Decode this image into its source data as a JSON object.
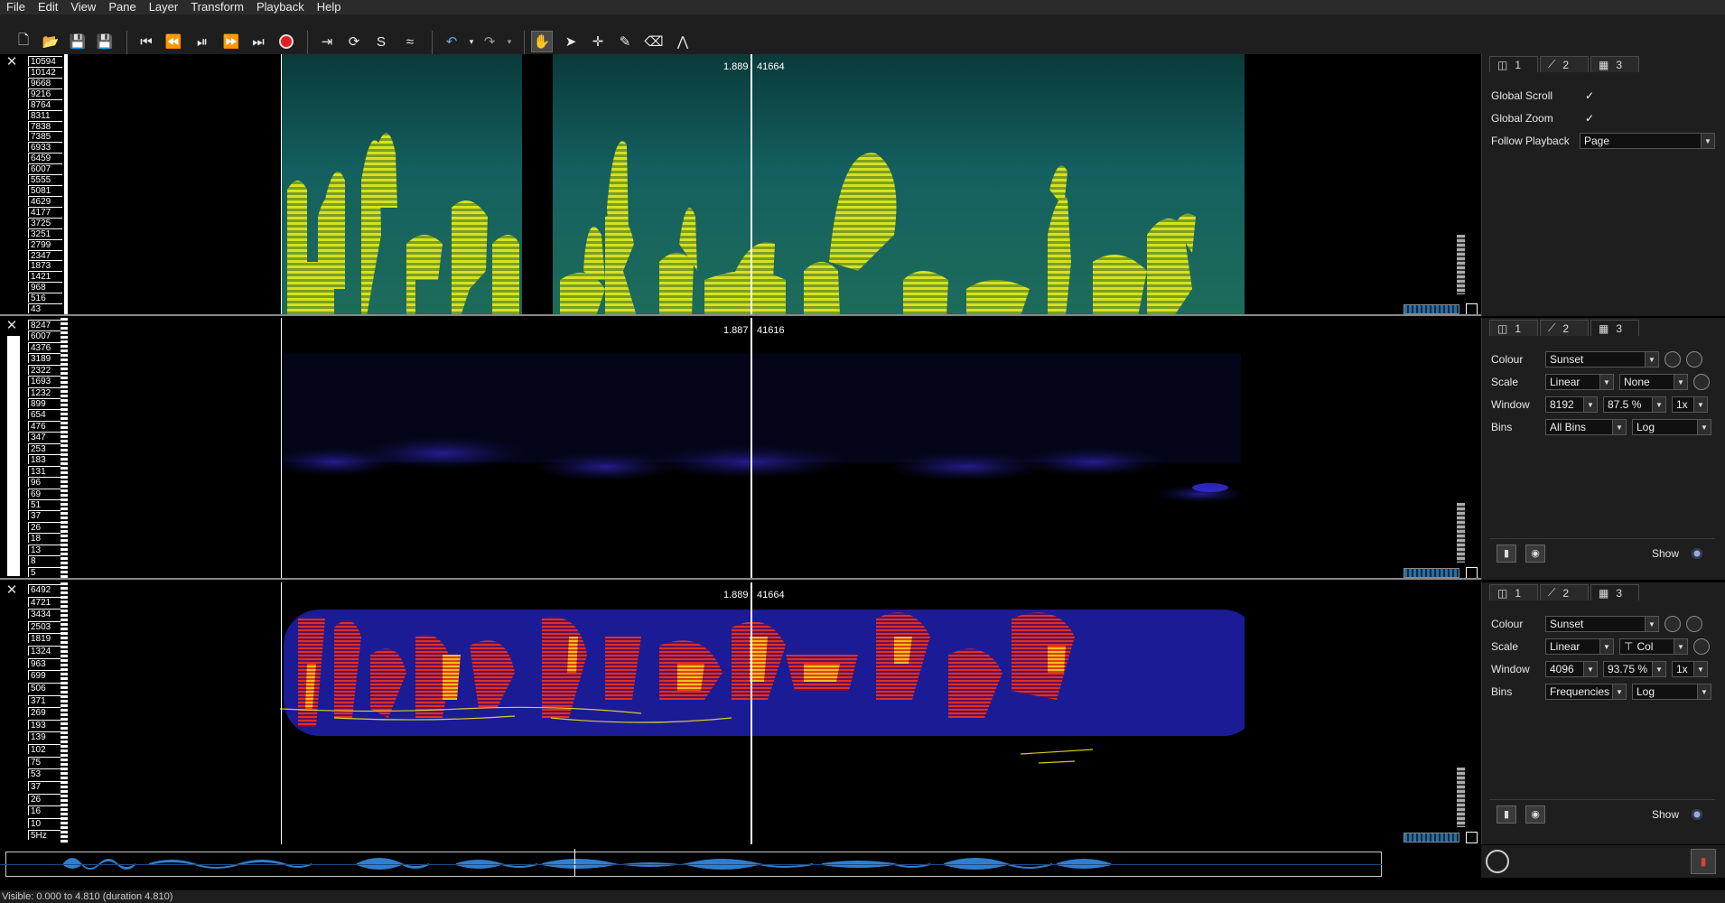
{
  "menu": [
    "File",
    "Edit",
    "View",
    "Pane",
    "Layer",
    "Transform",
    "Playback",
    "Help"
  ],
  "toolbar_icons": [
    "new-icon",
    "open-icon",
    "save-icon",
    "save-as-icon",
    "rewind-start-icon",
    "rewind-icon",
    "play-pause-icon",
    "fast-forward-icon",
    "fast-forward-end-icon",
    "record-icon",
    "play-selection-icon",
    "loop-icon",
    "solo-icon",
    "normalize-icon",
    "undo-icon",
    "redo-icon",
    "navigate-tool-icon",
    "select-tool-icon",
    "edit-tool-icon",
    "draw-tool-icon",
    "erase-tool-icon",
    "measure-tool-icon"
  ],
  "pane1": {
    "playhead_time": "1.889",
    "playhead_freq": "41664",
    "scale": [
      "10594",
      "10142",
      "9668",
      "9216",
      "8764",
      "8311",
      "7838",
      "7385",
      "6933",
      "6459",
      "6007",
      "5555",
      "5081",
      "4629",
      "4177",
      "3725",
      "3251",
      "2799",
      "2347",
      "1873",
      "1421",
      "968",
      "516",
      "43"
    ]
  },
  "pane2": {
    "playhead_time": "1.887",
    "playhead_freq": "41616",
    "scale": [
      "8247",
      "6007",
      "4376",
      "3189",
      "2322",
      "1693",
      "1232",
      "899",
      "654",
      "476",
      "347",
      "253",
      "183",
      "131",
      "96",
      "69",
      "51",
      "37",
      "26",
      "18",
      "13",
      "8",
      "5"
    ]
  },
  "pane3": {
    "playhead_time": "1.889",
    "playhead_freq": "41664",
    "scale": [
      "6492",
      "4721",
      "3434",
      "2503",
      "1819",
      "1324",
      "963",
      "699",
      "506",
      "371",
      "269",
      "193",
      "139",
      "102",
      "75",
      "53",
      "37",
      "26",
      "16",
      "10",
      "5Hz"
    ]
  },
  "panel1": {
    "tabs": [
      "1",
      "2",
      "3"
    ],
    "global_scroll_label": "Global Scroll",
    "global_scroll_checked": "✓",
    "global_zoom_label": "Global Zoom",
    "global_zoom_checked": "✓",
    "follow_label": "Follow Playback",
    "follow_value": "Page"
  },
  "panel2": {
    "tabs": [
      "1",
      "2",
      "3"
    ],
    "colour_label": "Colour",
    "colour_value": "Sunset",
    "scale_label": "Scale",
    "scale_value": "Linear",
    "scale_norm": "None",
    "window_label": "Window",
    "window_value": "8192",
    "overlap_value": "87.5 %",
    "oversample_value": "1x",
    "bins_label": "Bins",
    "bins_value": "All Bins",
    "bins_scale": "Log",
    "show_label": "Show"
  },
  "panel3": {
    "tabs": [
      "1",
      "2",
      "3"
    ],
    "colour_label": "Colour",
    "colour_value": "Sunset",
    "scale_label": "Scale",
    "scale_value": "Linear",
    "scale_norm": "Col",
    "window_label": "Window",
    "window_value": "4096",
    "overlap_value": "93.75 %",
    "oversample_value": "1x",
    "bins_label": "Bins",
    "bins_value": "Frequencies",
    "bins_scale": "Log",
    "show_label": "Show"
  },
  "status": "Visible: 0.000 to 4.810 (duration 4.810)"
}
